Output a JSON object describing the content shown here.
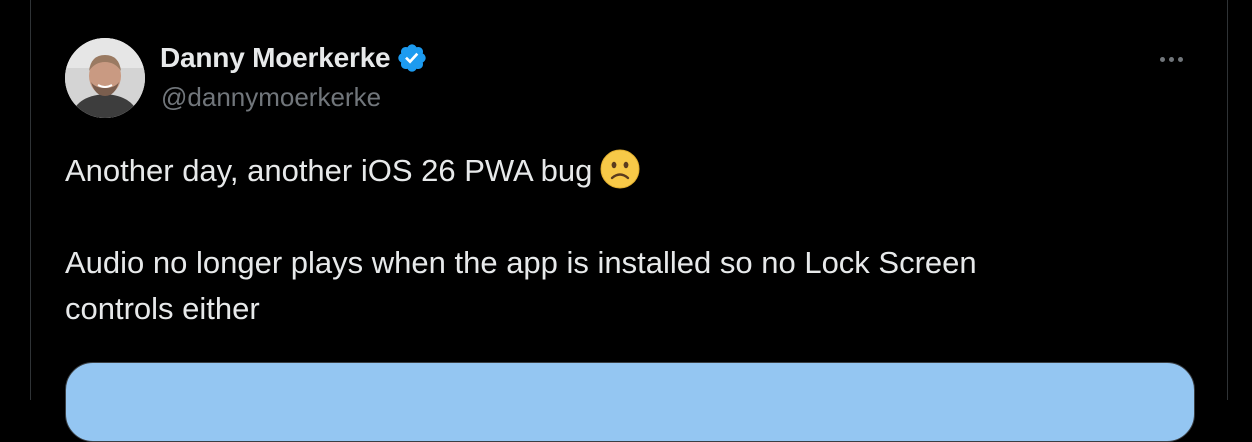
{
  "author": {
    "display_name": "Danny Moerkerke",
    "handle": "@dannymoerkerke",
    "verified": true,
    "avatar_icon": "user-photo"
  },
  "tweet": {
    "line1": "Another day, another iOS 26 PWA bug",
    "line1_emoji": "slightly-frowning-face",
    "line2": "Audio no longer plays when the app is installed so no Lock Screen",
    "line3": "controls either"
  },
  "icons": {
    "verified": "verified-badge-icon",
    "more": "more-options-icon"
  },
  "colors": {
    "background": "#000000",
    "text_primary": "#e7e9ea",
    "text_secondary": "#71767b",
    "verified_blue": "#1d9bf0",
    "border": "#2f3336",
    "media_preview": "#94c6f2"
  }
}
